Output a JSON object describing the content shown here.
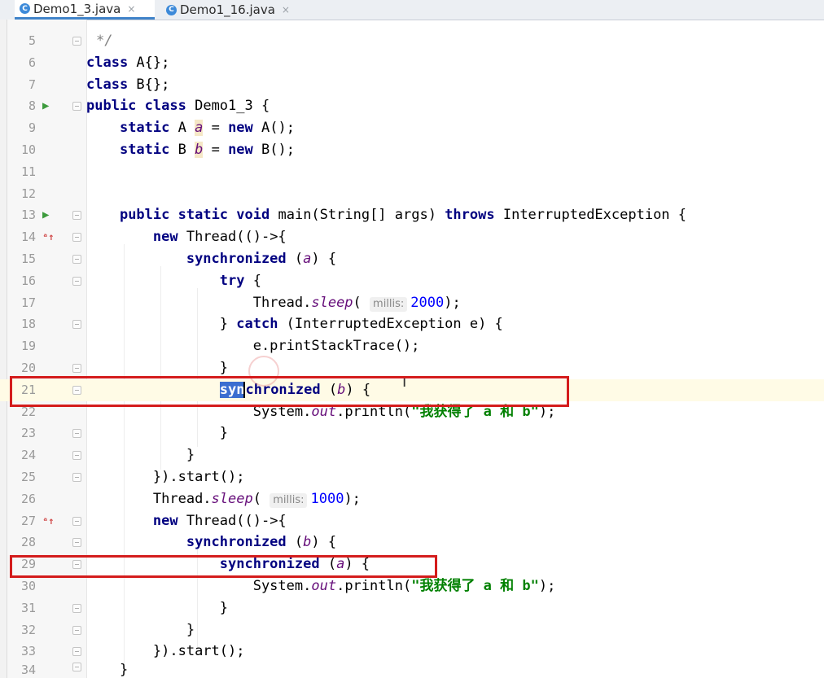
{
  "tabs": [
    {
      "label": "Demo1_3.java",
      "active": true,
      "icon": "java-class-icon",
      "close": "×"
    },
    {
      "label": "Demo1_16.java",
      "active": false,
      "icon": "java-class-icon",
      "close": "×"
    }
  ],
  "editor": {
    "lines": [
      {
        "n": "5"
      },
      {
        "n": "6"
      },
      {
        "n": "7"
      },
      {
        "n": "8"
      },
      {
        "n": "9"
      },
      {
        "n": "10"
      },
      {
        "n": "11"
      },
      {
        "n": "12"
      },
      {
        "n": "13"
      },
      {
        "n": "14"
      },
      {
        "n": "15"
      },
      {
        "n": "16"
      },
      {
        "n": "17"
      },
      {
        "n": "18"
      },
      {
        "n": "19"
      },
      {
        "n": "20"
      },
      {
        "n": "21"
      },
      {
        "n": "22"
      },
      {
        "n": "23"
      },
      {
        "n": "24"
      },
      {
        "n": "25"
      },
      {
        "n": "26"
      },
      {
        "n": "27"
      },
      {
        "n": "28"
      },
      {
        "n": "29"
      },
      {
        "n": "30"
      },
      {
        "n": "31"
      },
      {
        "n": "32"
      },
      {
        "n": "33"
      },
      {
        "n": "34"
      }
    ],
    "t": {
      "l5": "*/",
      "kw_class": "class",
      "a_decl": " A{};",
      "b_decl": " B{};",
      "kw_public": "public",
      "kw_static": "static",
      "kw_new": "new",
      "kw_void": "void",
      "kw_throws": "throws",
      "kw_sync": "synchronized",
      "kw_try": "try",
      "kw_catch": "catch",
      "demo": " Demo1_3 {",
      "typeA": " A ",
      "typeB": " B ",
      "fa": "a",
      "fb": "b",
      "eq": " = ",
      "ctorA": " A();",
      "ctorB": " B();",
      "main_sig": " main(String[] args) ",
      "iex": " InterruptedException {",
      "thread_lambda": " Thread(()->{",
      "paren_open": " (",
      "paren_close": ") {",
      "brace_open": " {",
      "thread_cls": "Thread.",
      "sleep": "sleep",
      "sleep_open": "( ",
      "millis": "millis:",
      "n2000": "2000",
      "n1000": "1000",
      "sleep_close": ");",
      "catch_close": "} ",
      "catch_args": " (InterruptedException e) {",
      "pst": "e.printStackTrace();",
      "rbrace": "}",
      "sel_part": "syn",
      "rest_sync": "chronized",
      "sys": "System.",
      "out": "out",
      "println": ".println(",
      "msg": "\"我获得了 a 和 b\"",
      "end_call": ");",
      "start": "}).start();"
    }
  },
  "colors": {
    "accent": "#4083c9",
    "annotation": "#d41c1c",
    "keyword": "#000080",
    "field": "#660e7a",
    "number": "#0000ff",
    "string": "#008000"
  }
}
